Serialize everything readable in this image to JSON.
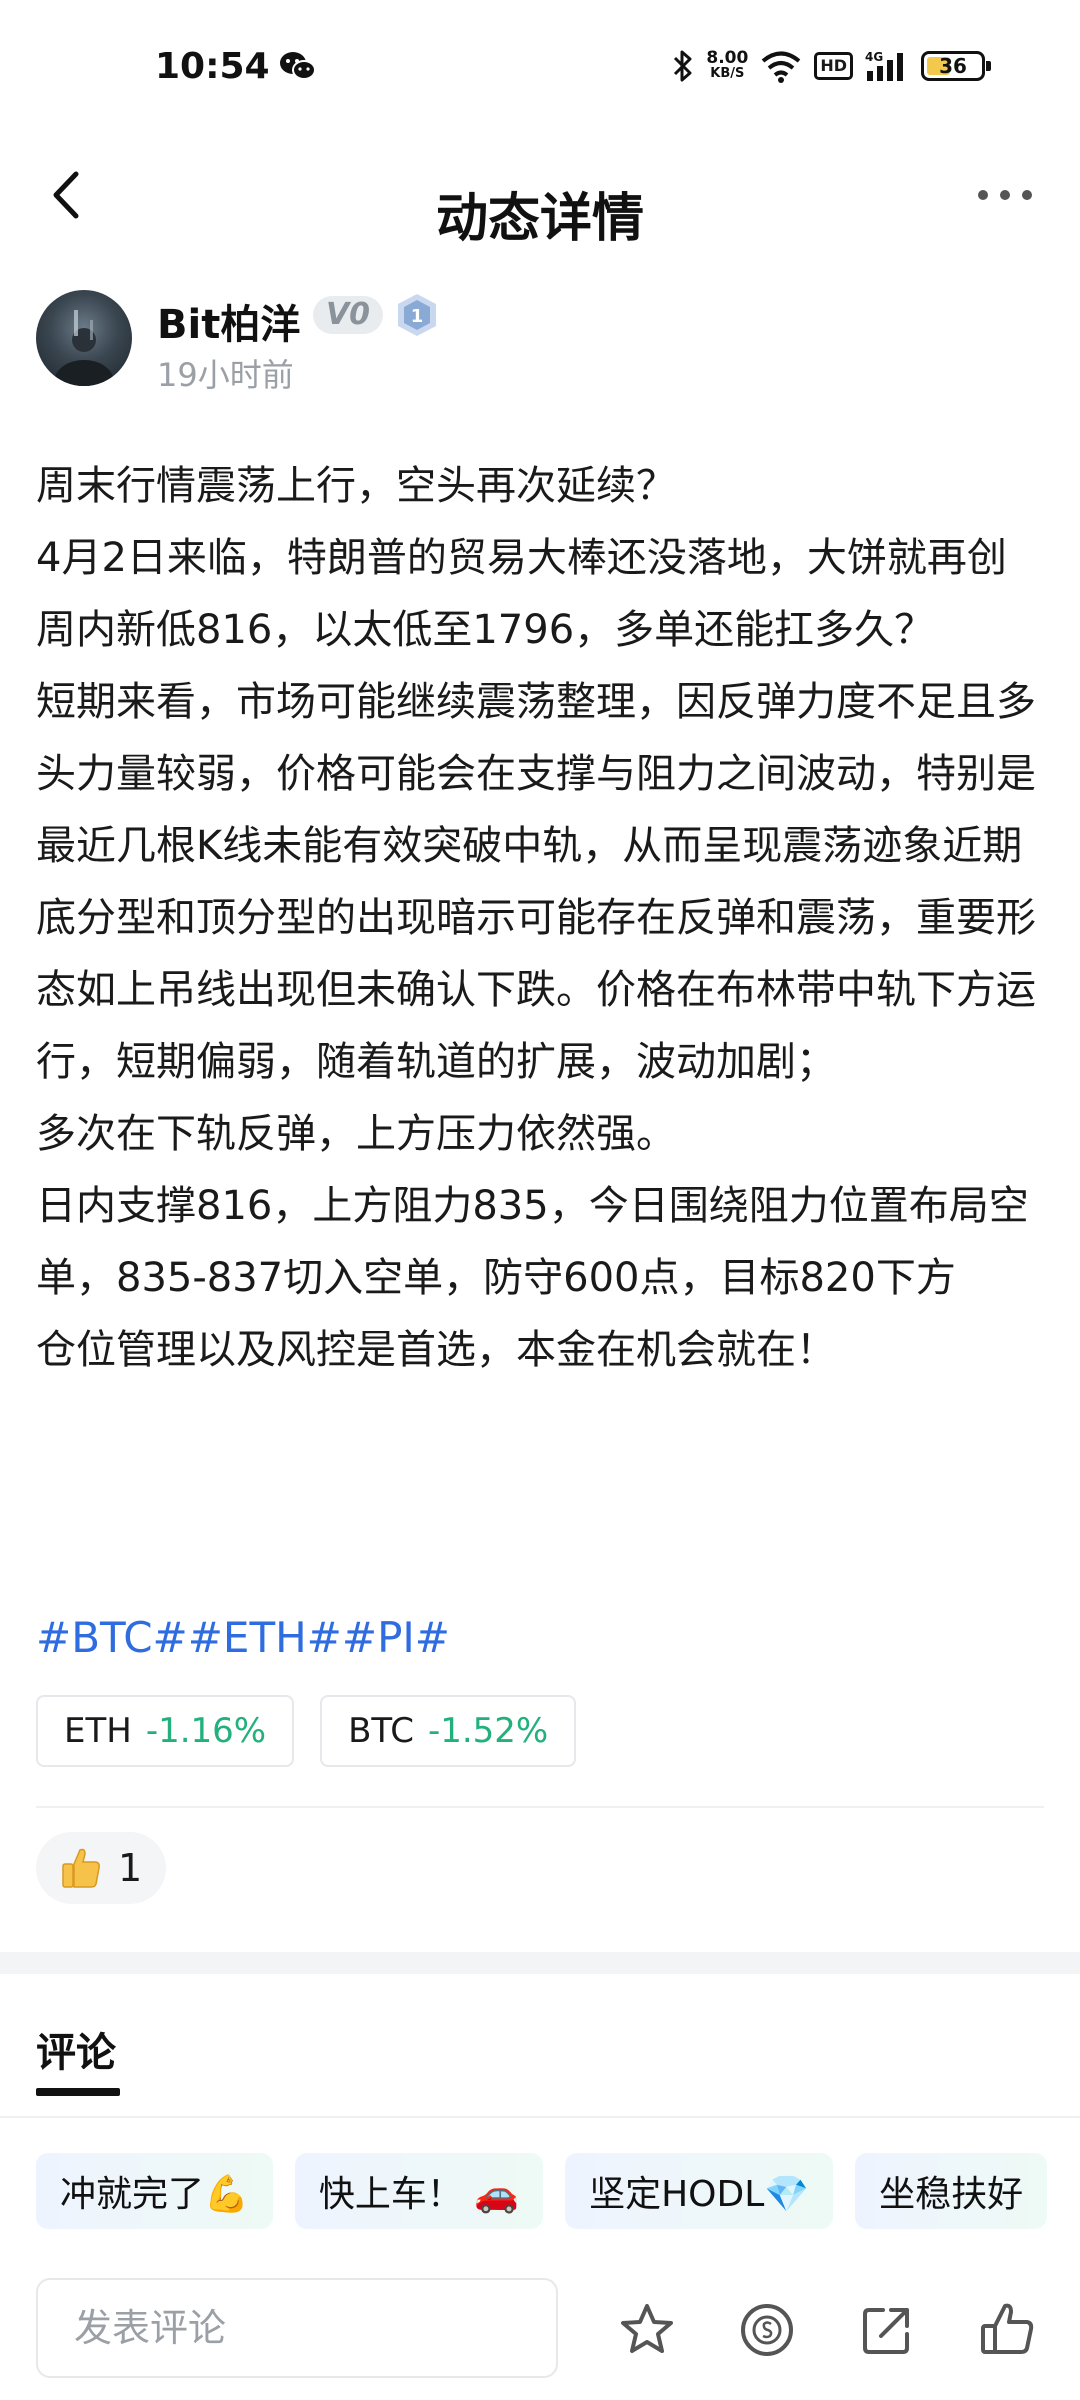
{
  "status_bar": {
    "time": "10:54",
    "network_speed_value": "8.00",
    "network_speed_unit": "KB/S",
    "hd_label": "HD",
    "signal_label": "4G",
    "battery_percent": "36",
    "icons": [
      "wechat-icon",
      "bluetooth-icon",
      "wifi-icon",
      "signal-icon",
      "battery-icon"
    ]
  },
  "nav": {
    "title": "动态详情",
    "back_icon": "chevron-left-icon",
    "more_icon": "more-icon"
  },
  "author": {
    "name": "Bit柏洋",
    "vip_badge": "V0",
    "level": "1",
    "time_ago": "19小时前"
  },
  "post": {
    "text": "周末行情震荡上行，空头再次延续？\n4月2日来临，特朗普的贸易大棒还没落地，大饼就再创周内新低816，以太低至1796，多单还能扛多久？\n短期来看，市场可能继续震荡整理，因反弹力度不足且多头力量较弱，价格可能会在支撑与阻力之间波动，特别是最近几根K线未能有效突破中轨，从而呈现震荡迹象近期底分型和顶分型的出现暗示可能存在反弹和震荡，重要形态如上吊线出现但未确认下跌。价格在布林带中轨下方运行，短期偏弱，随着轨道的扩展，波动加剧；\n多次在下轨反弹，上方压力依然强。\n日内支撑816，上方阻力835，今日围绕阻力位置布局空单，835-837切入空单，防守600点，目标820下方\n仓位管理以及风控是首选，本金在机会就在！",
    "tags": "#BTC##ETH##PI#"
  },
  "coins": [
    {
      "symbol": "ETH",
      "change": "-1.16%"
    },
    {
      "symbol": "BTC",
      "change": "-1.52%"
    }
  ],
  "reaction": {
    "count": "1"
  },
  "comments": {
    "title": "评论",
    "quick_replies": [
      "冲就完了💪",
      "快上车！ 🚗",
      "坚定HODL💎",
      "坐稳扶好"
    ],
    "input_placeholder": "发表评论"
  },
  "colors": {
    "accent_link": "#2f6ce0",
    "change_text": "#22b07d",
    "secondary_text": "#9aa0a6"
  }
}
